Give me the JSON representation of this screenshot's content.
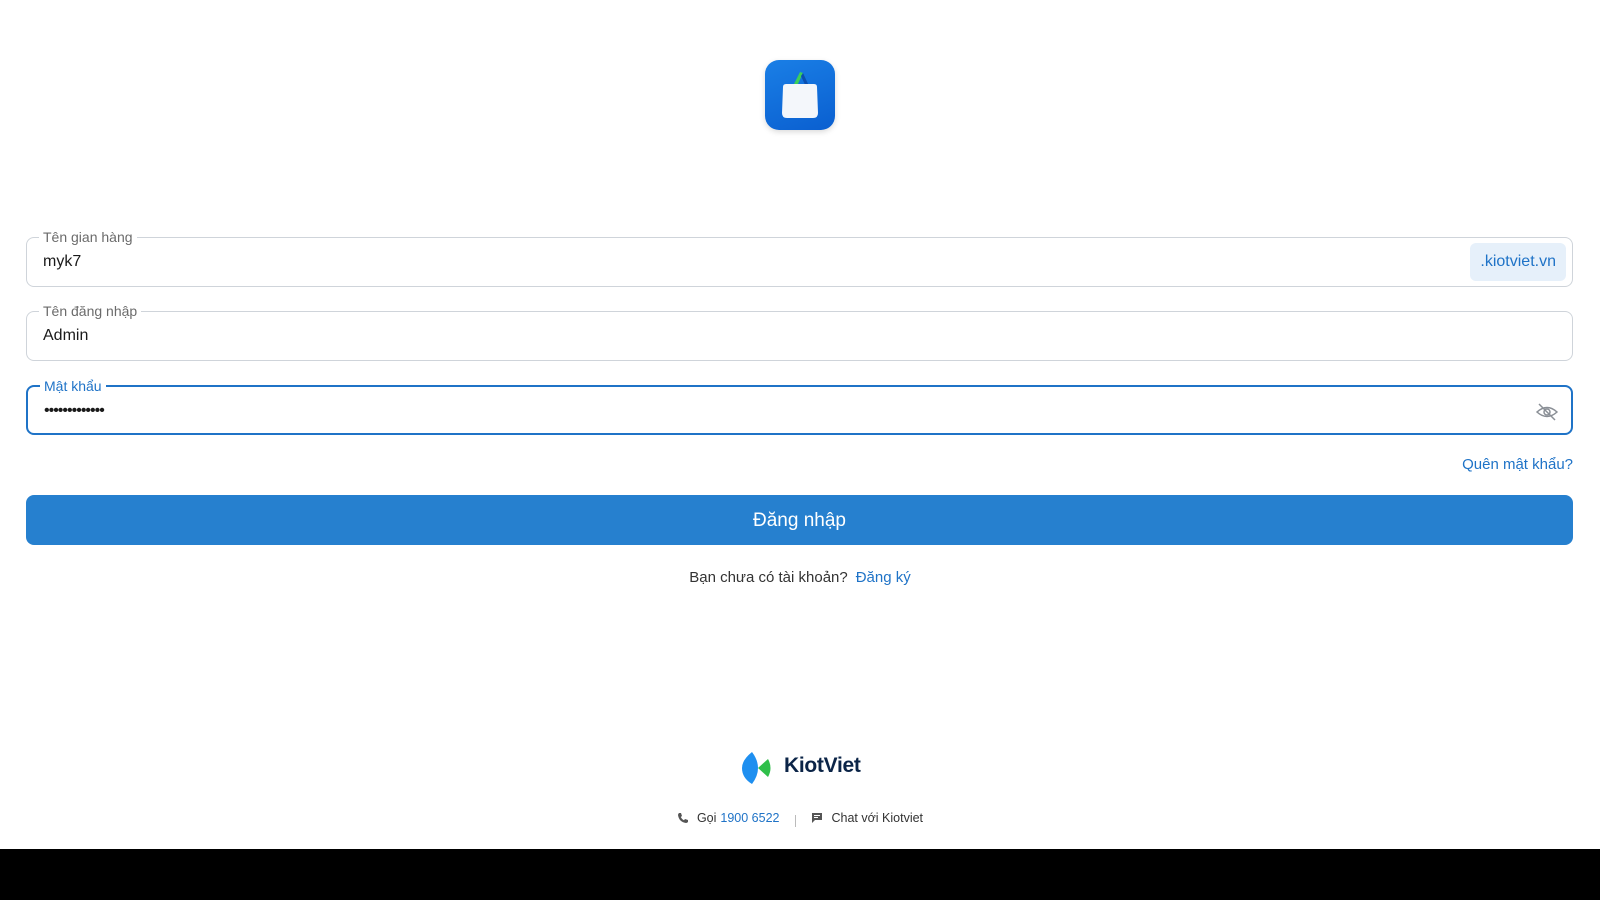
{
  "form": {
    "store": {
      "label": "Tên gian hàng",
      "value": "myk7",
      "suffix": ".kiotviet.vn"
    },
    "username": {
      "label": "Tên đăng nhập",
      "value": "Admin"
    },
    "password": {
      "label": "Mật khẩu",
      "value": "•••••••••••••"
    },
    "forgot_label": "Quên mật khẩu?",
    "login_label": "Đăng nhập"
  },
  "signup": {
    "prompt": "Bạn chưa có tài khoản?",
    "link": "Đăng ký"
  },
  "footer": {
    "brand": "KiotViet",
    "call_label": "Gọi",
    "phone": "1900 6522",
    "chat_label": "Chat với Kiotviet"
  },
  "colors": {
    "accent": "#2680cf",
    "link": "#1f73c7",
    "brand_dark": "#0b2447"
  },
  "icons": {
    "app": "shopping-bag-icon",
    "password_toggle": "eye-off-icon",
    "phone": "phone-icon",
    "chat": "chat-icon"
  }
}
